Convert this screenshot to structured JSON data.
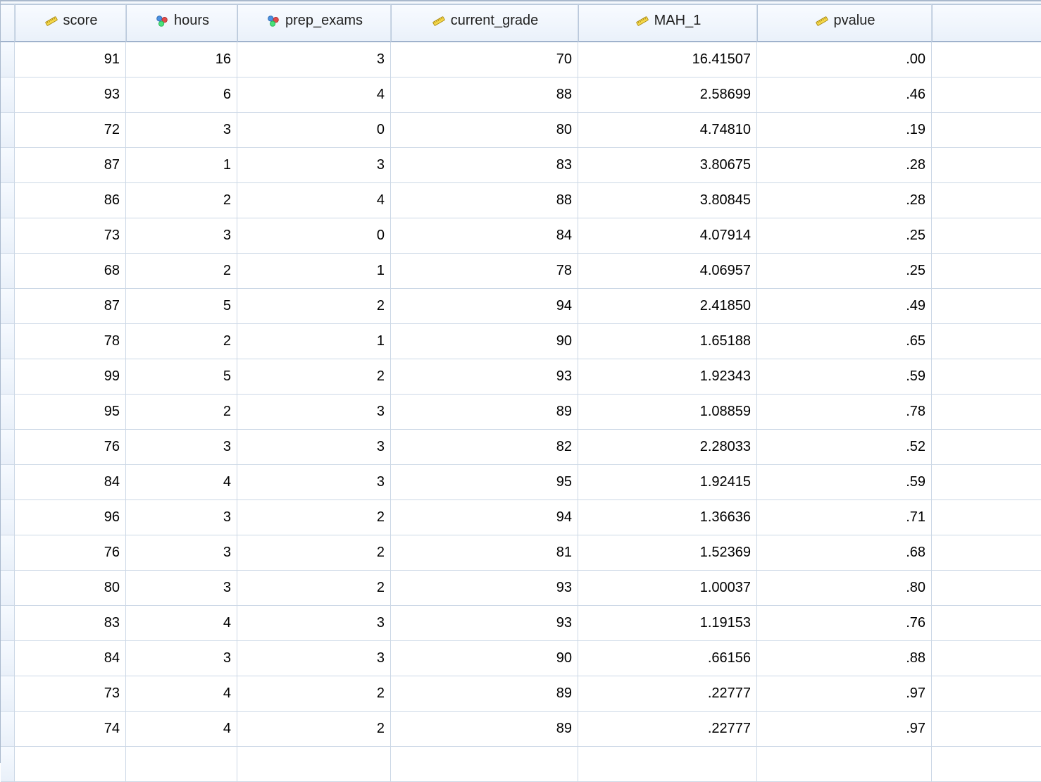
{
  "columns": [
    {
      "name": "score",
      "type": "scale"
    },
    {
      "name": "hours",
      "type": "nominal"
    },
    {
      "name": "prep_exams",
      "type": "nominal"
    },
    {
      "name": "current_grade",
      "type": "scale"
    },
    {
      "name": "MAH_1",
      "type": "scale"
    },
    {
      "name": "pvalue",
      "type": "scale"
    }
  ],
  "rows": [
    {
      "score": "91",
      "hours": "16",
      "prep_exams": "3",
      "current_grade": "70",
      "MAH_1": "16.41507",
      "pvalue": ".00"
    },
    {
      "score": "93",
      "hours": "6",
      "prep_exams": "4",
      "current_grade": "88",
      "MAH_1": "2.58699",
      "pvalue": ".46"
    },
    {
      "score": "72",
      "hours": "3",
      "prep_exams": "0",
      "current_grade": "80",
      "MAH_1": "4.74810",
      "pvalue": ".19"
    },
    {
      "score": "87",
      "hours": "1",
      "prep_exams": "3",
      "current_grade": "83",
      "MAH_1": "3.80675",
      "pvalue": ".28"
    },
    {
      "score": "86",
      "hours": "2",
      "prep_exams": "4",
      "current_grade": "88",
      "MAH_1": "3.80845",
      "pvalue": ".28"
    },
    {
      "score": "73",
      "hours": "3",
      "prep_exams": "0",
      "current_grade": "84",
      "MAH_1": "4.07914",
      "pvalue": ".25"
    },
    {
      "score": "68",
      "hours": "2",
      "prep_exams": "1",
      "current_grade": "78",
      "MAH_1": "4.06957",
      "pvalue": ".25"
    },
    {
      "score": "87",
      "hours": "5",
      "prep_exams": "2",
      "current_grade": "94",
      "MAH_1": "2.41850",
      "pvalue": ".49"
    },
    {
      "score": "78",
      "hours": "2",
      "prep_exams": "1",
      "current_grade": "90",
      "MAH_1": "1.65188",
      "pvalue": ".65"
    },
    {
      "score": "99",
      "hours": "5",
      "prep_exams": "2",
      "current_grade": "93",
      "MAH_1": "1.92343",
      "pvalue": ".59"
    },
    {
      "score": "95",
      "hours": "2",
      "prep_exams": "3",
      "current_grade": "89",
      "MAH_1": "1.08859",
      "pvalue": ".78"
    },
    {
      "score": "76",
      "hours": "3",
      "prep_exams": "3",
      "current_grade": "82",
      "MAH_1": "2.28033",
      "pvalue": ".52"
    },
    {
      "score": "84",
      "hours": "4",
      "prep_exams": "3",
      "current_grade": "95",
      "MAH_1": "1.92415",
      "pvalue": ".59"
    },
    {
      "score": "96",
      "hours": "3",
      "prep_exams": "2",
      "current_grade": "94",
      "MAH_1": "1.36636",
      "pvalue": ".71"
    },
    {
      "score": "76",
      "hours": "3",
      "prep_exams": "2",
      "current_grade": "81",
      "MAH_1": "1.52369",
      "pvalue": ".68"
    },
    {
      "score": "80",
      "hours": "3",
      "prep_exams": "2",
      "current_grade": "93",
      "MAH_1": "1.00037",
      "pvalue": ".80"
    },
    {
      "score": "83",
      "hours": "4",
      "prep_exams": "3",
      "current_grade": "93",
      "MAH_1": "1.19153",
      "pvalue": ".76"
    },
    {
      "score": "84",
      "hours": "3",
      "prep_exams": "3",
      "current_grade": "90",
      "MAH_1": ".66156",
      "pvalue": ".88"
    },
    {
      "score": "73",
      "hours": "4",
      "prep_exams": "2",
      "current_grade": "89",
      "MAH_1": ".22777",
      "pvalue": ".97"
    },
    {
      "score": "74",
      "hours": "4",
      "prep_exams": "2",
      "current_grade": "89",
      "MAH_1": ".22777",
      "pvalue": ".97"
    }
  ],
  "extra_blank_rows": 1
}
